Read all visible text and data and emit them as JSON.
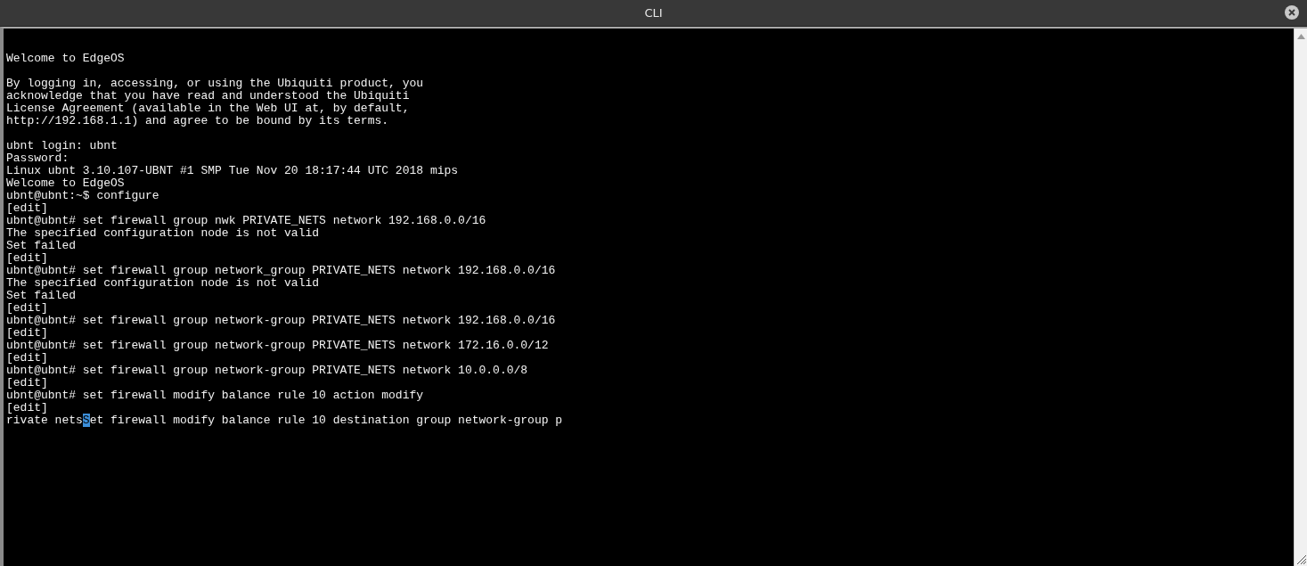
{
  "window": {
    "title": "CLI"
  },
  "terminal": {
    "paragraphs": [
      [
        "Welcome to EdgeOS"
      ],
      [
        "By logging in, accessing, or using the Ubiquiti product, you",
        "acknowledge that you have read and understood the Ubiquiti",
        "License Agreement (available in the Web UI at, by default,",
        "http://192.168.1.1) and agree to be bound by its terms."
      ],
      [
        "ubnt login: ubnt",
        "Password:",
        "Linux ubnt 3.10.107-UBNT #1 SMP Tue Nov 20 18:17:44 UTC 2018 mips",
        "Welcome to EdgeOS",
        "ubnt@ubnt:~$ configure",
        "[edit]",
        "ubnt@ubnt# set firewall group nwk PRIVATE_NETS network 192.168.0.0/16",
        "The specified configuration node is not valid",
        "Set failed",
        "[edit]",
        "ubnt@ubnt# set firewall group network_group PRIVATE_NETS network 192.168.0.0/16",
        "The specified configuration node is not valid",
        "Set failed",
        "[edit]",
        "ubnt@ubnt# set firewall group network-group PRIVATE_NETS network 192.168.0.0/16",
        "[edit]",
        "ubnt@ubnt# set firewall group network-group PRIVATE_NETS network 172.16.0.0/12",
        "[edit]",
        "ubnt@ubnt# set firewall group network-group PRIVATE_NETS network 10.0.0.0/8",
        "[edit]",
        "ubnt@ubnt# set firewall modify balance rule 10 action modify",
        "[edit]"
      ]
    ],
    "input_line": {
      "before_cursor": "rivate nets",
      "at_cursor": "S",
      "after_cursor": "et firewall modify balance rule 10 destination group network-group p"
    }
  }
}
